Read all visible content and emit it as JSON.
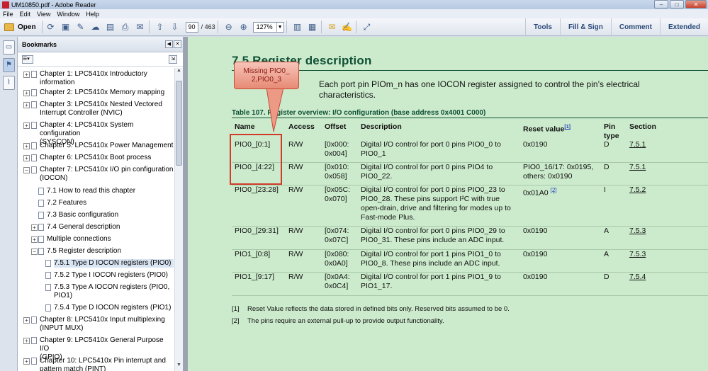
{
  "window": {
    "title": "UM10850.pdf - Adobe Reader",
    "buttons": {
      "minimize": "–",
      "maximize": "□",
      "close": "✕"
    }
  },
  "menu": [
    "File",
    "Edit",
    "View",
    "Window",
    "Help"
  ],
  "toolbar": {
    "open_label": "Open",
    "page_current": "90",
    "page_total": "/ 463",
    "zoom": "127%",
    "right_tabs": [
      "Tools",
      "Fill & Sign",
      "Comment",
      "Extended"
    ]
  },
  "bookmarks": {
    "title": "Bookmarks",
    "items": [
      {
        "label": "Chapter 1: LPC5410x Introductory information",
        "lines": [
          "Chapter 1: LPC5410x Introductory",
          "information"
        ],
        "toggle": "+",
        "level": 0
      },
      {
        "label": "Chapter 2: LPC5410x Memory mapping",
        "lines": [
          "Chapter 2: LPC5410x Memory mapping"
        ],
        "toggle": "+",
        "level": 0
      },
      {
        "label": "Chapter 3: LPC5410x Nested Vectored Interrupt Controller (NVIC)",
        "lines": [
          "Chapter 3: LPC5410x Nested Vectored",
          "Interrupt Controller (NVIC)"
        ],
        "toggle": "+",
        "level": 0
      },
      {
        "label": "Chapter 4: LPC5410x System configuration (SYSCON)",
        "lines": [
          "Chapter 4: LPC5410x System configuration",
          "(SYSCON)"
        ],
        "toggle": "+",
        "level": 0
      },
      {
        "label": "Chapter 5: LPC5410x Power Management",
        "lines": [
          "Chapter 5: LPC5410x Power Management"
        ],
        "toggle": "+",
        "level": 0
      },
      {
        "label": "Chapter 6: LPC5410x Boot process",
        "lines": [
          "Chapter 6: LPC5410x Boot process"
        ],
        "toggle": "+",
        "level": 0
      },
      {
        "label": "Chapter 7: LPC5410x I/O pin configuration (IOCON)",
        "lines": [
          "Chapter 7: LPC5410x I/O pin configuration",
          "(IOCON)"
        ],
        "toggle": "−",
        "level": 0
      },
      {
        "label": "7.1 How to read this chapter",
        "lines": [
          "7.1 How to read this chapter"
        ],
        "toggle": "",
        "level": 1
      },
      {
        "label": "7.2 Features",
        "lines": [
          "7.2 Features"
        ],
        "toggle": "",
        "level": 1
      },
      {
        "label": "7.3 Basic configuration",
        "lines": [
          "7.3 Basic configuration"
        ],
        "toggle": "",
        "level": 1
      },
      {
        "label": "7.4 General description",
        "lines": [
          "7.4 General description"
        ],
        "toggle": "+",
        "level": 1
      },
      {
        "label": "Multiple connections",
        "lines": [
          "Multiple connections"
        ],
        "toggle": "+",
        "level": 1
      },
      {
        "label": "7.5 Register description",
        "lines": [
          "7.5 Register description"
        ],
        "toggle": "−",
        "level": 1
      },
      {
        "label": "7.5.1 Type D IOCON registers (PIO0)",
        "lines": [
          "7.5.1 Type D IOCON registers (PIO0)"
        ],
        "toggle": "",
        "level": 2,
        "selected": true
      },
      {
        "label": "7.5.2 Type I IOCON registers (PIO0)",
        "lines": [
          "7.5.2 Type I IOCON registers (PIO0)"
        ],
        "toggle": "",
        "level": 2
      },
      {
        "label": "7.5.3 Type A IOCON registers (PIO0, PIO1)",
        "lines": [
          "7.5.3 Type A IOCON registers (PIO0,",
          "PIO1)"
        ],
        "toggle": "",
        "level": 2
      },
      {
        "label": "7.5.4 Type D IOCON registers (PIO1)",
        "lines": [
          "7.5.4 Type D IOCON registers (PIO1)"
        ],
        "toggle": "",
        "level": 2
      },
      {
        "label": "Chapter 8: LPC5410x Input multiplexing (INPUT MUX)",
        "lines": [
          "Chapter 8: LPC5410x Input multiplexing",
          "(INPUT MUX)"
        ],
        "toggle": "+",
        "level": 0
      },
      {
        "label": "Chapter 9: LPC5410x General Purpose I/O (GPIO)",
        "lines": [
          "Chapter 9: LPC5410x General Purpose I/O",
          "(GPIO)"
        ],
        "toggle": "+",
        "level": 0
      },
      {
        "label": "Chapter 10: LPC5410x Pin interrupt and pattern match (PINT)",
        "lines": [
          "Chapter 10: LPC5410x Pin interrupt and",
          "pattern match (PINT)"
        ],
        "toggle": "+",
        "level": 0
      }
    ]
  },
  "document": {
    "section_title": "7.5 Register description",
    "intro": "Each port pin PIOm_n has one IOCON register assigned to control the pin’s electrical characteristics.",
    "table_caption": "Table 107.    Register overview: I/O configuration (base address 0x4001 C000)",
    "headers": {
      "name": "Name",
      "access": "Access",
      "offset": "Offset",
      "description": "Description",
      "reset": "Reset value",
      "reset_note": "[1]",
      "pin_type_1": "Pin",
      "pin_type_2": "type",
      "section": "Section"
    },
    "rows": [
      {
        "name": "PIO0_[0:1]",
        "access": "R/W",
        "offset": [
          "[0x000:",
          "0x004]"
        ],
        "description": [
          "Digital I/O control for port 0 pins PIO0_0 to",
          "PIO0_1"
        ],
        "reset": [
          "0x0190"
        ],
        "reset_note": "",
        "pin_type": "D",
        "section": "7.5.1"
      },
      {
        "name": "PIO0_[4:22]",
        "access": "R/W",
        "offset": [
          "[0x010:",
          "0x058]"
        ],
        "description": [
          "Digital I/O control for port 0 pins PIO4 to",
          "PIO0_22."
        ],
        "reset": [
          "PIO0_16/17: 0x0195,",
          "others: 0x0190"
        ],
        "reset_note": "",
        "pin_type": "D",
        "section": "7.5.1"
      },
      {
        "name": "PIO0_[23:28]",
        "access": "R/W",
        "offset": [
          "[0x05C:",
          "0x070]"
        ],
        "description": [
          "Digital I/O control for port 0 pins PIO0_23 to",
          "PIO0_28. These pins support I²C with true",
          "open-drain, drive and filtering for modes up to",
          "Fast-mode Plus."
        ],
        "reset": [
          "0x01A0"
        ],
        "reset_note": "[2]",
        "pin_type": "I",
        "section": "7.5.2"
      },
      {
        "name": "PIO0_[29:31]",
        "access": "R/W",
        "offset": [
          "[0x074:",
          "0x07C]"
        ],
        "description": [
          "Digital I/O control for port 0 pins PIO0_29 to",
          "PIO0_31. These pins include an ADC input."
        ],
        "reset": [
          "0x0190"
        ],
        "reset_note": "",
        "pin_type": "A",
        "section": "7.5.3"
      },
      {
        "name": "PIO1_[0:8]",
        "access": "R/W",
        "offset": [
          "[0x080:",
          "0x0A0]"
        ],
        "description": [
          "Digital I/O control for port 1 pins PIO1_0 to",
          "PIO0_8. These pins include an ADC input."
        ],
        "reset": [
          "0x0190"
        ],
        "reset_note": "",
        "pin_type": "A",
        "section": "7.5.3"
      },
      {
        "name": "PIO1_[9:17]",
        "access": "R/W",
        "offset": [
          "[0x0A4:",
          "0x0C4]"
        ],
        "description": [
          "Digital I/O control for port 1 pins PIO1_9 to",
          "PIO1_17."
        ],
        "reset": [
          "0x0190"
        ],
        "reset_note": "",
        "pin_type": "D",
        "section": "7.5.4"
      }
    ],
    "footnotes": [
      {
        "num": "[1]",
        "text": "Reset Value reflects the data stored in defined bits only. Reserved bits assumed to be 0."
      },
      {
        "num": "[2]",
        "text": "The pins require an external pull-up to provide output functionality."
      }
    ]
  },
  "annotation": {
    "callout_lines": [
      "Missing PIO0_",
      "2,PIO0_3"
    ],
    "color": "#d23a2a"
  }
}
